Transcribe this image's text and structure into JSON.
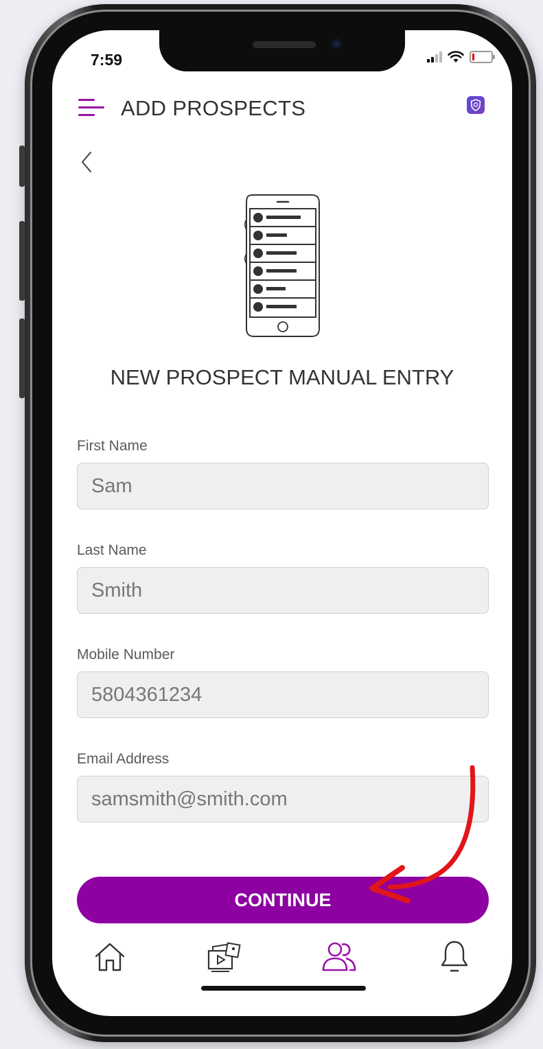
{
  "status_bar": {
    "time": "7:59"
  },
  "header": {
    "title": "ADD PROSPECTS"
  },
  "page": {
    "heading": "NEW PROSPECT MANUAL ENTRY"
  },
  "form": {
    "first_name": {
      "label": "First Name",
      "value": "Sam"
    },
    "last_name": {
      "label": "Last Name",
      "value": "Smith"
    },
    "mobile": {
      "label": "Mobile Number",
      "value": "5804361234"
    },
    "email": {
      "label": "Email Address",
      "value": "samsmith@smith.com"
    }
  },
  "actions": {
    "continue_label": "CONTINUE"
  },
  "nav": {
    "items": [
      {
        "icon": "home-icon",
        "active": false
      },
      {
        "icon": "media-library-icon",
        "active": false
      },
      {
        "icon": "prospects-icon",
        "active": true
      },
      {
        "icon": "bell-icon",
        "active": false
      }
    ]
  },
  "colors": {
    "accent": "#8e00a2",
    "annotation_arrow": "#e0161b",
    "input_bg": "#efefef"
  }
}
